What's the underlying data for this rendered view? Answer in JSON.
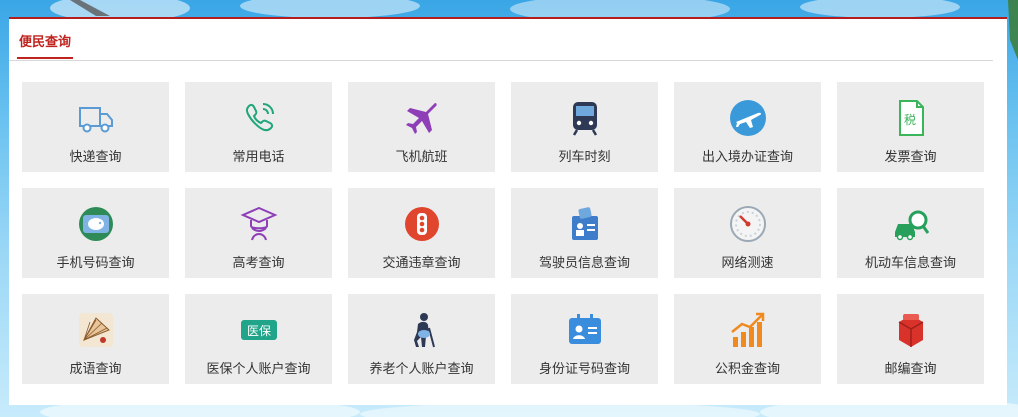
{
  "section": {
    "title": "便民查询"
  },
  "colors": {
    "accent": "#c0241f",
    "tile_bg": "#ececec"
  },
  "tiles": [
    {
      "label": "快递查询",
      "icon": "truck-icon"
    },
    {
      "label": "常用电话",
      "icon": "phone-icon"
    },
    {
      "label": "飞机航班",
      "icon": "airplane-icon"
    },
    {
      "label": "列车时刻",
      "icon": "train-icon"
    },
    {
      "label": "出入境办证查询",
      "icon": "plane-circle-icon"
    },
    {
      "label": "发票查询",
      "icon": "invoice-icon"
    },
    {
      "label": "手机号码查询",
      "icon": "piggy-bank-icon"
    },
    {
      "label": "高考查询",
      "icon": "graduation-icon"
    },
    {
      "label": "交通违章查询",
      "icon": "traffic-light-icon"
    },
    {
      "label": "驾驶员信息查询",
      "icon": "driver-card-icon"
    },
    {
      "label": "网络测速",
      "icon": "speedometer-icon"
    },
    {
      "label": "机动车信息查询",
      "icon": "car-search-icon"
    },
    {
      "label": "成语查询",
      "icon": "fan-icon"
    },
    {
      "label": "医保个人账户查询",
      "icon": "medical-insurance-icon",
      "badge": "医保"
    },
    {
      "label": "养老个人账户查询",
      "icon": "elder-icon"
    },
    {
      "label": "身份证号码查询",
      "icon": "id-card-icon"
    },
    {
      "label": "公积金查询",
      "icon": "growth-chart-icon"
    },
    {
      "label": "邮编查询",
      "icon": "mailbox-icon"
    }
  ]
}
